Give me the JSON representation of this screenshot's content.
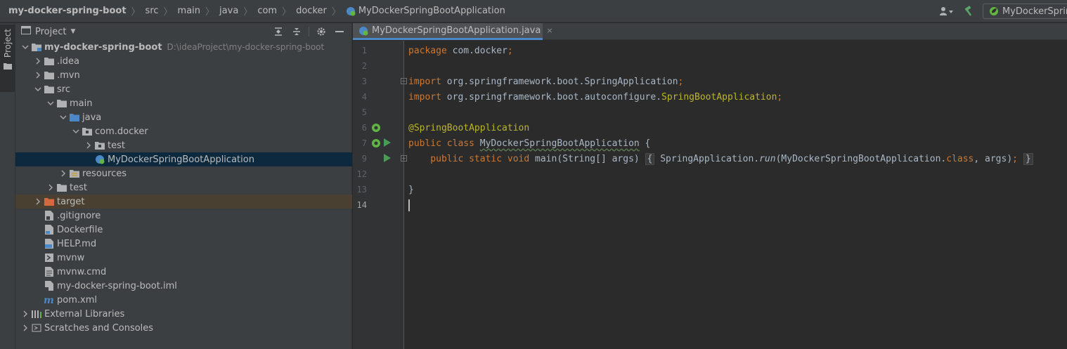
{
  "breadcrumbs": [
    {
      "label": "my-docker-spring-boot",
      "bold": true
    },
    {
      "label": "src"
    },
    {
      "label": "main"
    },
    {
      "label": "java"
    },
    {
      "label": "com"
    },
    {
      "label": "docker"
    },
    {
      "label": "MyDockerSpringBootApplication",
      "icon": "spring-class-icon"
    }
  ],
  "toolbar": {
    "run_config_label": "MyDockerSpring",
    "icons": [
      "user-icon",
      "hammer-icon"
    ]
  },
  "sidebar": {
    "stripe_label": "Project"
  },
  "project_panel": {
    "title": "Project",
    "tools": [
      "expand-all-icon",
      "collapse-all-icon",
      "gear-icon",
      "minimize-icon"
    ],
    "tree": [
      {
        "label": "my-docker-spring-boot",
        "path": "D:\\ideaProject\\my-docker-spring-boot",
        "depth": 0,
        "arrow": "down",
        "icon": "module-folder-icon",
        "bold": true
      },
      {
        "label": ".idea",
        "depth": 1,
        "arrow": "right",
        "icon": "folder-icon"
      },
      {
        "label": ".mvn",
        "depth": 1,
        "arrow": "right",
        "icon": "folder-icon"
      },
      {
        "label": "src",
        "depth": 1,
        "arrow": "down",
        "icon": "folder-icon"
      },
      {
        "label": "main",
        "depth": 2,
        "arrow": "down",
        "icon": "folder-icon"
      },
      {
        "label": "java",
        "depth": 3,
        "arrow": "down",
        "icon": "source-folder-icon"
      },
      {
        "label": "com.docker",
        "depth": 4,
        "arrow": "down",
        "icon": "package-icon"
      },
      {
        "label": "test",
        "depth": 5,
        "arrow": "right",
        "icon": "package-icon"
      },
      {
        "label": "MyDockerSpringBootApplication",
        "depth": 5,
        "arrow": "none",
        "icon": "spring-class-icon",
        "selected": true
      },
      {
        "label": "resources",
        "depth": 3,
        "arrow": "right",
        "icon": "resources-folder-icon"
      },
      {
        "label": "test",
        "depth": 2,
        "arrow": "right",
        "icon": "folder-icon"
      },
      {
        "label": "target",
        "depth": 1,
        "arrow": "right",
        "icon": "excluded-folder-icon",
        "excluded": true
      },
      {
        "label": ".gitignore",
        "depth": 1,
        "arrow": "none",
        "icon": "gitignore-file-icon"
      },
      {
        "label": "Dockerfile",
        "depth": 1,
        "arrow": "none",
        "icon": "docker-file-icon"
      },
      {
        "label": "HELP.md",
        "depth": 1,
        "arrow": "none",
        "icon": "markdown-file-icon"
      },
      {
        "label": "mvnw",
        "depth": 1,
        "arrow": "none",
        "icon": "shell-file-icon"
      },
      {
        "label": "mvnw.cmd",
        "depth": 1,
        "arrow": "none",
        "icon": "text-file-icon"
      },
      {
        "label": "my-docker-spring-boot.iml",
        "depth": 1,
        "arrow": "none",
        "icon": "iml-file-icon"
      },
      {
        "label": "pom.xml",
        "depth": 1,
        "arrow": "none",
        "icon": "maven-file-icon"
      },
      {
        "label": "External Libraries",
        "depth": 0,
        "arrow": "right",
        "icon": "libraries-icon"
      },
      {
        "label": "Scratches and Consoles",
        "depth": 0,
        "arrow": "right",
        "icon": "scratches-icon"
      }
    ]
  },
  "editor": {
    "tab_label": "MyDockerSpringBootApplication.java",
    "tab_close": "×",
    "lines": [
      {
        "num": "1",
        "segments": [
          {
            "t": "package",
            "c": "kw"
          },
          {
            "t": " com.docker"
          },
          {
            "t": ";",
            "c": "kw"
          }
        ]
      },
      {
        "num": "2",
        "segments": []
      },
      {
        "num": "3",
        "fold": true,
        "segments": [
          {
            "t": "import",
            "c": "kw"
          },
          {
            "t": " org.springframework.boot.SpringApplication"
          },
          {
            "t": ";",
            "c": "kw"
          }
        ]
      },
      {
        "num": "4",
        "segments": [
          {
            "t": "import",
            "c": "kw"
          },
          {
            "t": " org.springframework.boot.autoconfigure."
          },
          {
            "t": "SpringBootApplication",
            "c": "ann"
          },
          {
            "t": ";",
            "c": "kw"
          }
        ]
      },
      {
        "num": "5",
        "segments": []
      },
      {
        "num": "6",
        "gutter": [
          "spring-bean-icon"
        ],
        "segments": [
          {
            "t": "@SpringBootApplication",
            "c": "ann"
          }
        ]
      },
      {
        "num": "7",
        "gutter": [
          "spring-bean-icon",
          "run-icon"
        ],
        "segments": [
          {
            "t": "public class ",
            "c": "kw"
          },
          {
            "t": "MyDockerSpringBootApplication",
            "c": "squiggle"
          },
          {
            "t": " {"
          }
        ]
      },
      {
        "num": "9",
        "gutter": [
          "run-icon"
        ],
        "fold": true,
        "segments": [
          {
            "t": "    public static void ",
            "c": "kw"
          },
          {
            "t": "main"
          },
          {
            "t": "(String[] args) "
          },
          {
            "t": "{",
            "c": "fold"
          },
          {
            "t": " SpringApplication."
          },
          {
            "t": "run",
            "c": "ital"
          },
          {
            "t": "(MyDockerSpringBootApplication."
          },
          {
            "t": "class",
            "c": "kw"
          },
          {
            "t": ", args)"
          },
          {
            "t": ";",
            "c": "kw"
          },
          {
            "t": " "
          },
          {
            "t": "}",
            "c": "fold"
          }
        ]
      },
      {
        "num": "12",
        "segments": []
      },
      {
        "num": "13",
        "segments": [
          {
            "t": "}"
          }
        ]
      },
      {
        "num": "14",
        "active": true,
        "caret": true,
        "segments": []
      }
    ]
  },
  "colors": {
    "panel_bg": "#3c3f41",
    "editor_bg": "#2b2b2b",
    "selection": "#0d293e",
    "excluded_bg": "#4a4032",
    "keyword": "#cc7832",
    "annotation": "#bbb529",
    "accent": "#4a88c7"
  }
}
